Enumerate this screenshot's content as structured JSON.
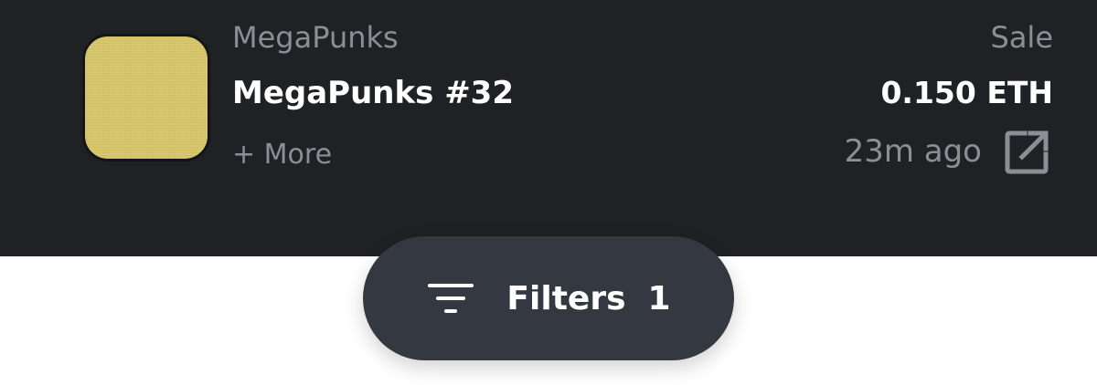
{
  "activity": {
    "collection_name": "MegaPunks",
    "item_name": "MegaPunks #32",
    "more_label": "+ More",
    "event_type": "Sale",
    "price": "0.150 ETH",
    "time_ago": "23m ago",
    "thumbnail_color": "#d8c76a",
    "link_icon": "external-link-icon"
  },
  "filters": {
    "label": "Filters",
    "count": "1",
    "icon": "filter-lines-icon"
  },
  "colors": {
    "row_background": "#202124",
    "muted_text": "#8b8e95",
    "primary_text": "#ffffff",
    "filter_button": "#343841"
  }
}
